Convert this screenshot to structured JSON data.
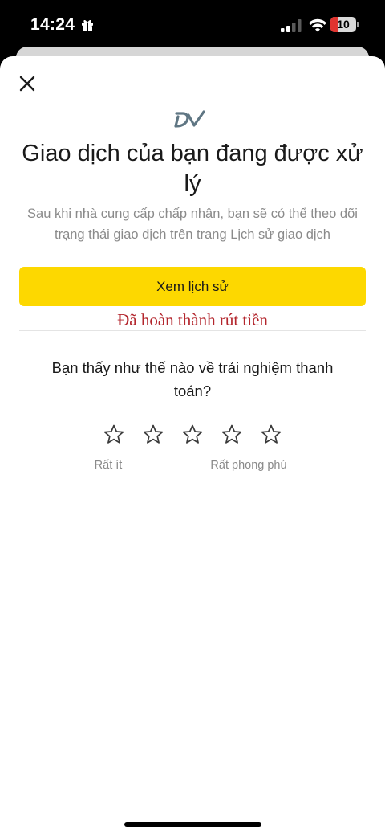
{
  "status_bar": {
    "time": "14:24",
    "battery": "10",
    "battery_level": 0.1,
    "icons": [
      "gift-icon",
      "signal-icon",
      "wifi-icon",
      "battery-icon"
    ]
  },
  "sheet": {
    "close_icon": "close-icon",
    "logo_icon": "brand-logo-icon",
    "title": "Giao dịch của bạn đang được xử lý",
    "subtitle": "Sau khi nhà cung cấp chấp nhận, bạn sẽ có thể theo dõi trạng thái giao dịch trên trang Lịch sử giao dịch",
    "primary_button": "Xem lịch sử",
    "stamp_text": "Đã hoàn thành rút tiền",
    "question": "Bạn thấy như thế nào về trải nghiệm thanh toán?",
    "rating": {
      "max": 5,
      "value": 0,
      "low_label": "Rất ít",
      "high_label": "Rất phong phú"
    }
  },
  "colors": {
    "accent": "#fdd800",
    "stamp": "#b3262d",
    "text": "#1a1a1a",
    "muted": "#8a8a8a",
    "battery_low": "#e0342f"
  }
}
